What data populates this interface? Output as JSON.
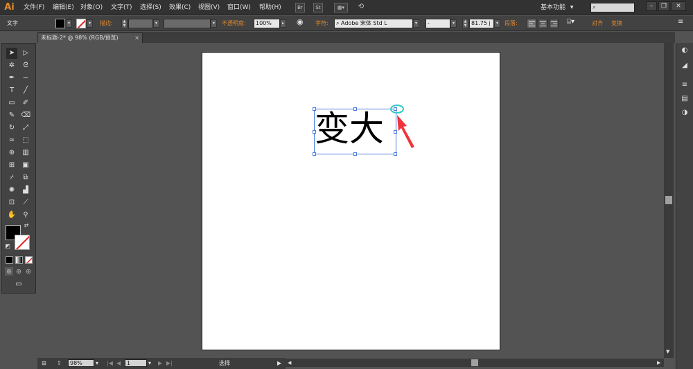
{
  "app": {
    "logo": "Ai",
    "menu": [
      "文件(F)",
      "编辑(E)",
      "对象(O)",
      "文字(T)",
      "选择(S)",
      "效果(C)",
      "视图(V)",
      "窗口(W)",
      "帮助(H)"
    ],
    "bridge_label": "Br",
    "stock_label": "St",
    "workspace": "基本功能",
    "workspace_arrow": "▾"
  },
  "control_bar": {
    "tool_label": "文字",
    "stroke_label": "描边:",
    "opacity_label": "不透明度:",
    "opacity_value": "100%",
    "character_label": "字符:",
    "font_family": "Adobe 宋体 Std L",
    "font_style": "-",
    "font_size": "81.75 j",
    "paragraph_label": "段落:",
    "align_label": "对齐",
    "transform_label": "变换",
    "fill_color": "#000000",
    "stroke_color": "#ffffff"
  },
  "document": {
    "tab_title": "未标题-2* @ 98% (RGB/预览)",
    "tab_close": "×",
    "artboard_text": "变大"
  },
  "status_bar": {
    "zoom": "98%",
    "page": "1",
    "tool_status": "选择"
  },
  "annotation": {
    "circle_color": "#2ec9c9",
    "arrow_color": "#f0343c"
  }
}
